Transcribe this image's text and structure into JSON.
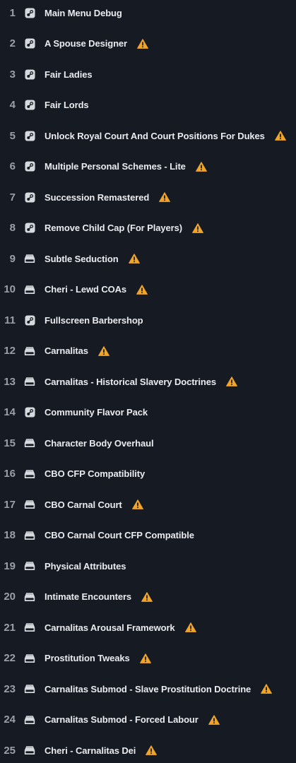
{
  "colors": {
    "background": "#161a23",
    "text": "#e9ebef",
    "number": "#9aa0aa",
    "icon": "#d6d9de",
    "warning": "#f0a52a"
  },
  "mods": [
    {
      "index": "1",
      "name": "Main Menu Debug",
      "source": "steam",
      "warning": false
    },
    {
      "index": "2",
      "name": "A Spouse Designer",
      "source": "steam",
      "warning": true
    },
    {
      "index": "3",
      "name": "Fair Ladies",
      "source": "steam",
      "warning": false
    },
    {
      "index": "4",
      "name": "Fair Lords",
      "source": "steam",
      "warning": false
    },
    {
      "index": "5",
      "name": "Unlock Royal Court And Court Positions For Dukes",
      "source": "steam",
      "warning": true
    },
    {
      "index": "6",
      "name": "Multiple Personal Schemes - Lite",
      "source": "steam",
      "warning": true
    },
    {
      "index": "7",
      "name": "Succession Remastered",
      "source": "steam",
      "warning": true
    },
    {
      "index": "8",
      "name": "Remove Child Cap (For Players)",
      "source": "steam",
      "warning": true
    },
    {
      "index": "9",
      "name": "Subtle Seduction",
      "source": "local",
      "warning": true
    },
    {
      "index": "10",
      "name": "Cheri - Lewd COAs",
      "source": "local",
      "warning": true
    },
    {
      "index": "11",
      "name": "Fullscreen Barbershop",
      "source": "steam",
      "warning": false
    },
    {
      "index": "12",
      "name": "Carnalitas",
      "source": "local",
      "warning": true
    },
    {
      "index": "13",
      "name": "Carnalitas - Historical Slavery Doctrines",
      "source": "local",
      "warning": true
    },
    {
      "index": "14",
      "name": "Community Flavor Pack",
      "source": "steam",
      "warning": false
    },
    {
      "index": "15",
      "name": "Character Body Overhaul",
      "source": "local",
      "warning": false
    },
    {
      "index": "16",
      "name": "CBO CFP Compatibility",
      "source": "local",
      "warning": false
    },
    {
      "index": "17",
      "name": "CBO Carnal Court",
      "source": "local",
      "warning": true
    },
    {
      "index": "18",
      "name": "CBO Carnal Court CFP Compatible",
      "source": "local",
      "warning": false
    },
    {
      "index": "19",
      "name": "Physical Attributes",
      "source": "local",
      "warning": false
    },
    {
      "index": "20",
      "name": "Intimate Encounters",
      "source": "local",
      "warning": true
    },
    {
      "index": "21",
      "name": "Carnalitas Arousal Framework",
      "source": "local",
      "warning": true
    },
    {
      "index": "22",
      "name": "Prostitution Tweaks",
      "source": "local",
      "warning": true
    },
    {
      "index": "23",
      "name": "Carnalitas Submod - Slave Prostitution Doctrine",
      "source": "local",
      "warning": true
    },
    {
      "index": "24",
      "name": "Carnalitas Submod - Forced Labour",
      "source": "local",
      "warning": true
    },
    {
      "index": "25",
      "name": "Cheri - Carnalitas Dei",
      "source": "local",
      "warning": true
    }
  ]
}
